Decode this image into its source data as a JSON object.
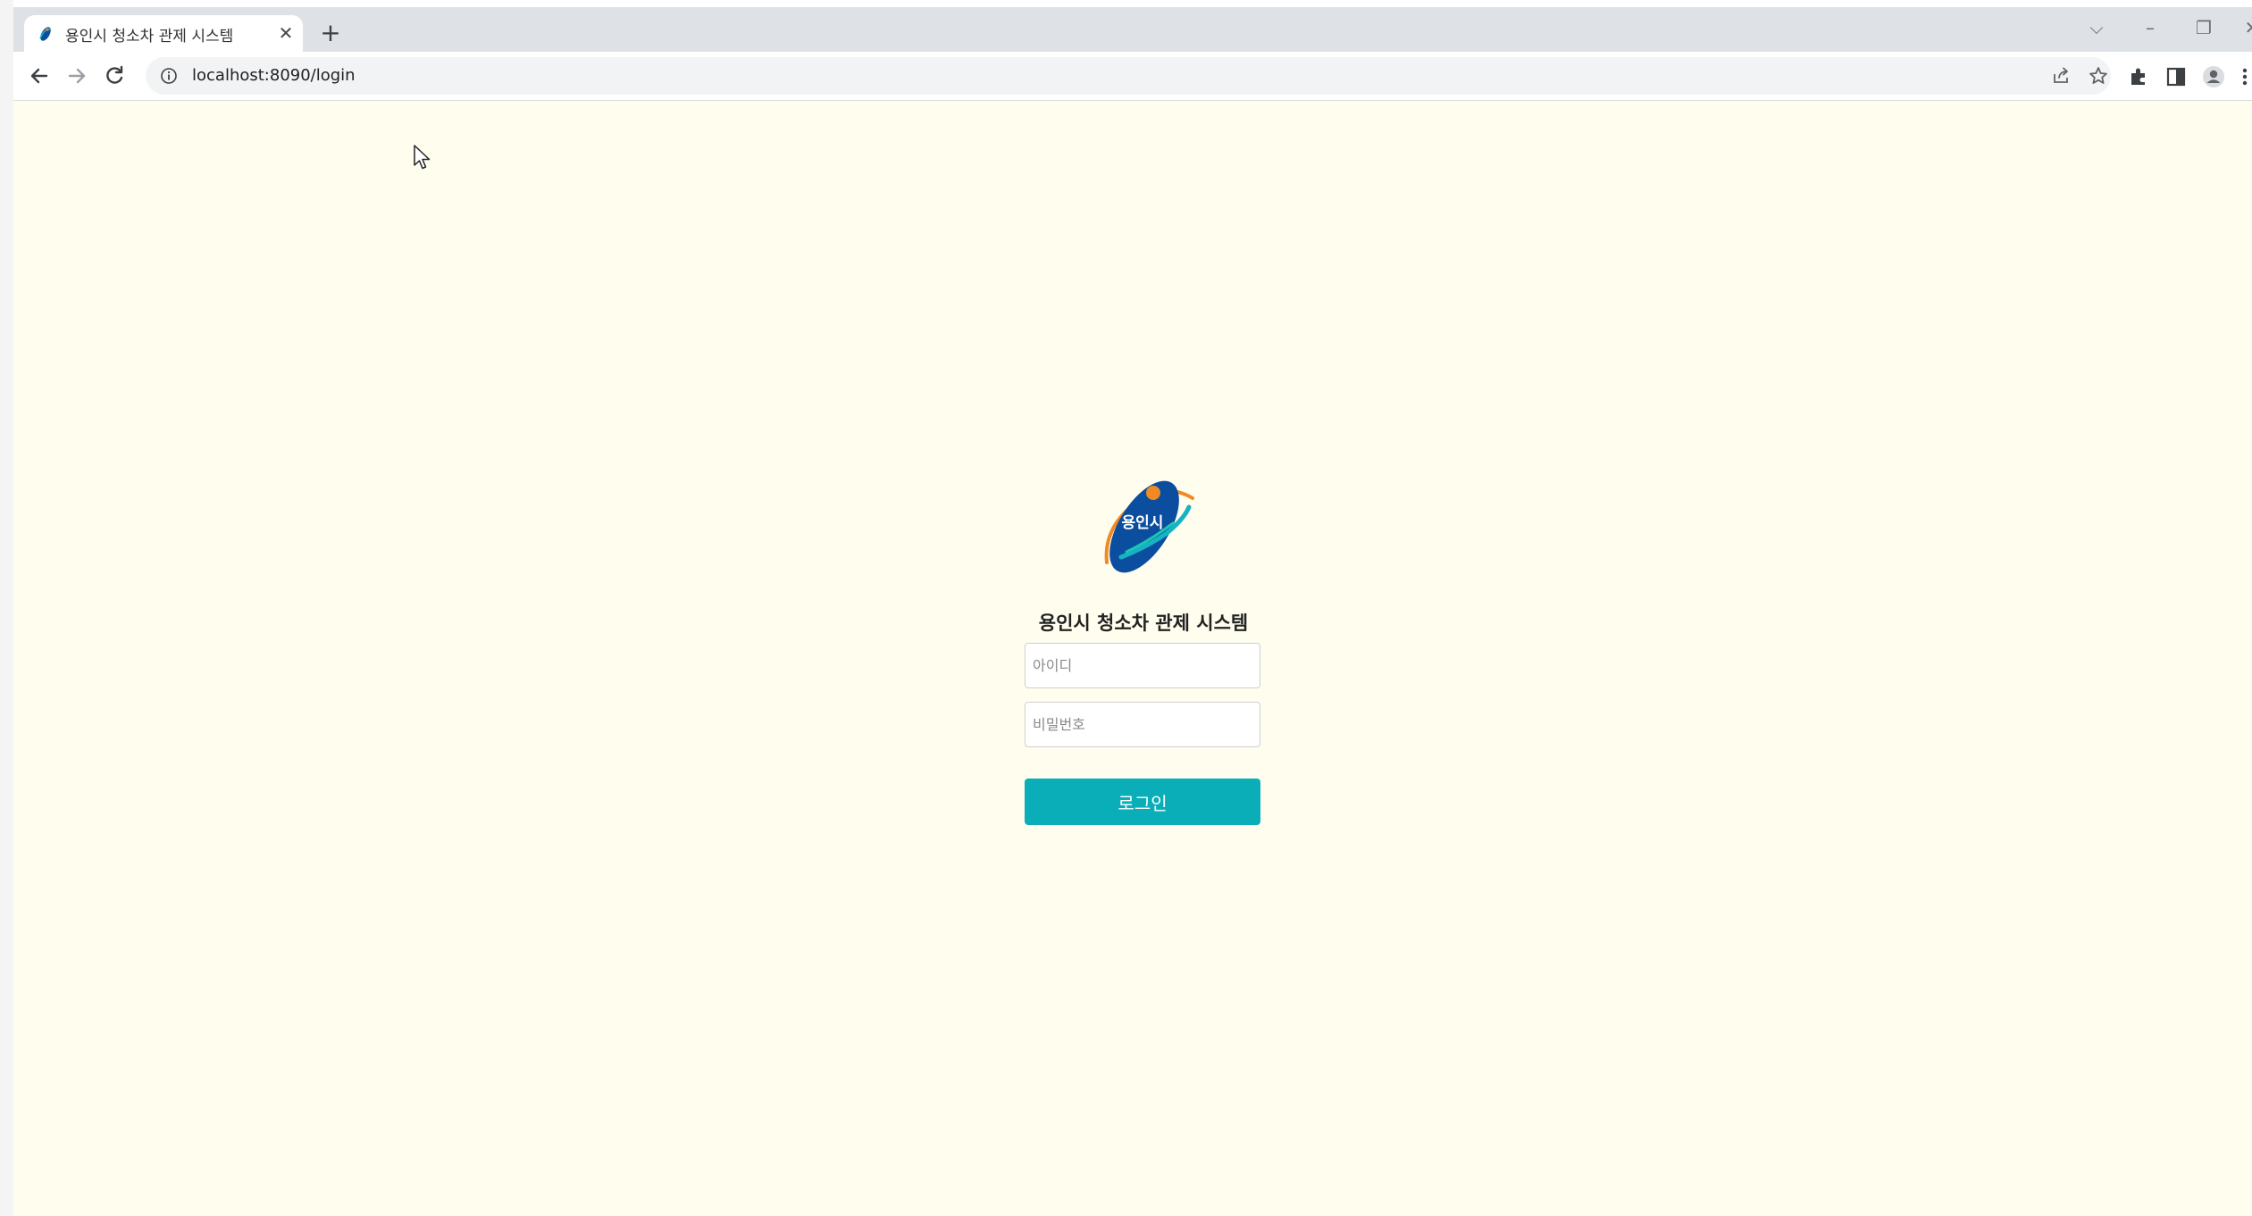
{
  "browser": {
    "tab_title": "용인시 청소차 관제 시스템",
    "tab_close": "✕",
    "new_tab": "+",
    "url": "localhost:8090/login",
    "window_controls": {
      "tab_search": "⌵",
      "minimize": "–",
      "restore": "❐",
      "close": "✕"
    }
  },
  "login": {
    "logo_text": "용인시",
    "title": "용인시 청소차 관제 시스템",
    "id_placeholder": "아이디",
    "password_placeholder": "비밀번호",
    "button_label": "로그인"
  },
  "colors": {
    "page_background": "#fefdee",
    "login_button": "#0aaeb9",
    "logo_blue": "#0b4e9f",
    "logo_orange": "#f08a24",
    "logo_teal": "#15b3c4"
  },
  "icons": [
    "favicon-icon",
    "close-icon",
    "plus-icon",
    "back-icon",
    "forward-icon",
    "reload-icon",
    "info-icon",
    "share-icon",
    "star-icon",
    "extensions-icon",
    "side-panel-icon",
    "profile-icon",
    "menu-icon",
    "cursor-icon"
  ]
}
